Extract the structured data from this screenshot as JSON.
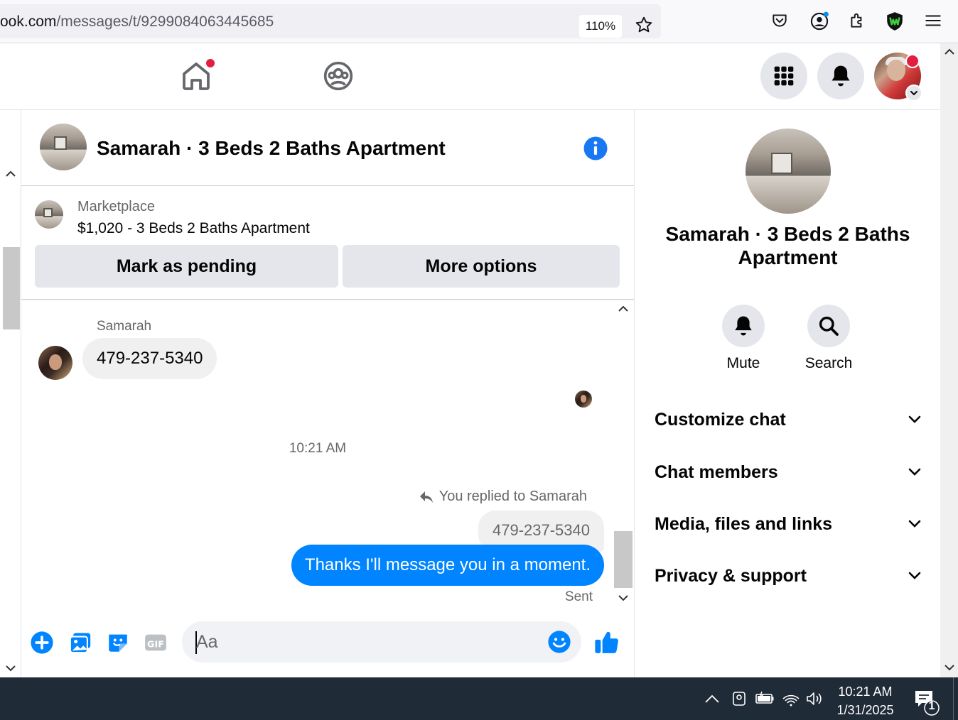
{
  "browser": {
    "url_main": "ook.com",
    "url_path": "/messages/t/9299084063445685",
    "zoom": "110%"
  },
  "header": {
    "home_has_notification": true
  },
  "chat": {
    "title": "Samarah · 3 Beds 2 Baths Apartment",
    "marketplace_label": "Marketplace",
    "listing": "$1,020 - 3 Beds 2 Baths Apartment",
    "mark_pending": "Mark as pending",
    "more_options": "More options"
  },
  "messages": {
    "sender": "Samarah",
    "received_text": "479-237-5340",
    "timestamp": "10:21 AM",
    "replied_label": "You replied to Samarah",
    "quoted_text": "479-237-5340",
    "sent_text": "Thanks I'll message you in a moment.",
    "sent_status": "Sent"
  },
  "composer": {
    "placeholder": "Aa"
  },
  "right_panel": {
    "title": "Samarah · 3 Beds 2 Baths Apartment",
    "mute_label": "Mute",
    "search_label": "Search",
    "sections": [
      "Customize chat",
      "Chat members",
      "Media, files and links",
      "Privacy & support"
    ]
  },
  "taskbar": {
    "time": "10:21 AM",
    "date": "1/31/2025",
    "notification_count": "1"
  },
  "colors": {
    "messenger_blue": "#0084ff",
    "fb_blue": "#1877f2",
    "notification_red": "#e41e3f",
    "taskbar": "#202b38"
  }
}
